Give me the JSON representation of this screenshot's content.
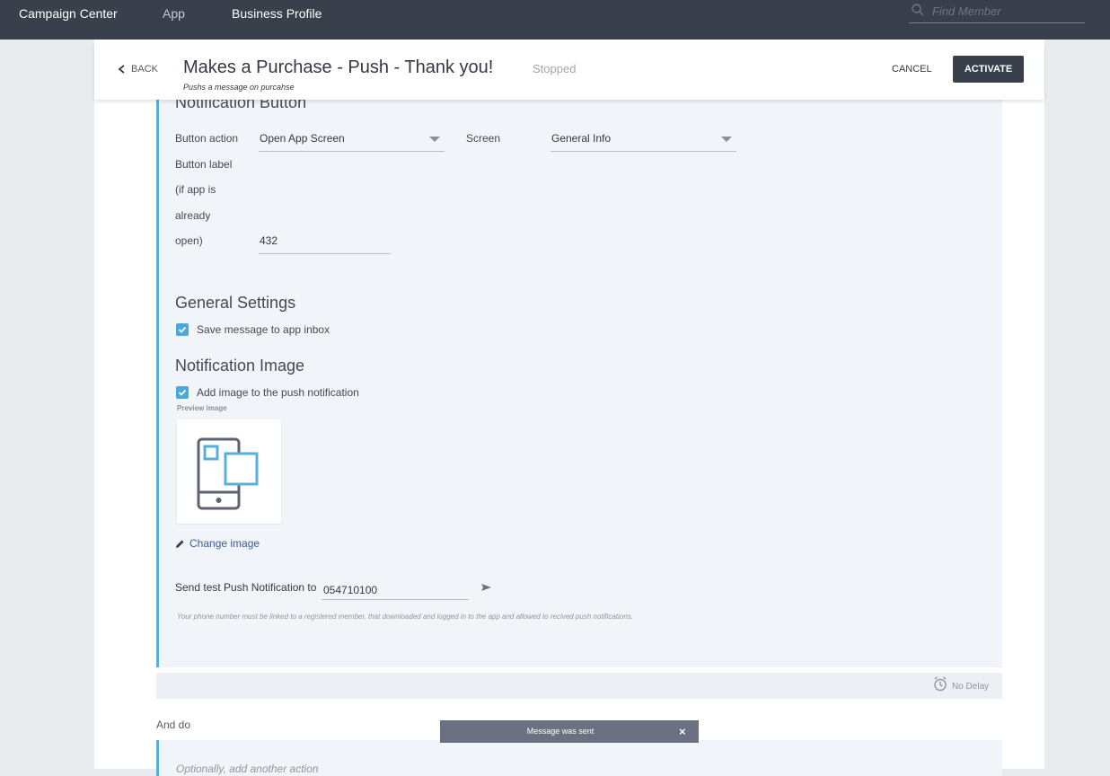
{
  "topnav": {
    "items": [
      {
        "label": "Campaign Center"
      },
      {
        "label": "App"
      },
      {
        "label": "Business Profile"
      }
    ],
    "search_placeholder": "Find Member"
  },
  "header": {
    "back_label": "BACK",
    "title": "Makes a Purchase - Push - Thank you!",
    "subtitle": "Pushs a message on purcahse",
    "status": "Stopped",
    "cancel_label": "CANCEL",
    "activate_label": "ACTIVATE"
  },
  "notification_button": {
    "heading": "Notification Button",
    "button_action_label": "Button action",
    "button_action_value": "Open App Screen",
    "screen_label": "Screen",
    "screen_value": "General Info",
    "button_label_lines": [
      "Button label",
      "(if app is",
      "already",
      "open)"
    ],
    "button_label_value": "432"
  },
  "general_settings": {
    "heading": "General Settings",
    "save_inbox_label": "Save message to app inbox",
    "save_inbox_checked": true
  },
  "notification_image": {
    "heading": "Notification Image",
    "add_image_label": "Add image to the push notification",
    "add_image_checked": true,
    "preview_label": "Preview image",
    "change_image_label": "Change image"
  },
  "test_push": {
    "label": "Send test Push Notification to",
    "value": "054710100",
    "note": "Your phone number must be linked to a registered member, that downloaded and logged in to the app and allowed to recived push notifications."
  },
  "delay": {
    "label": "No Delay"
  },
  "and_do": {
    "label": "And do",
    "optional_label": "Optionally, add another action"
  },
  "toast": {
    "message": "Message was sent",
    "close": "×"
  },
  "colors": {
    "nav_bg": "#3a3f4c",
    "accent_blue": "#5aafd9",
    "checkbox_blue": "#4da7db",
    "link_blue": "#3a5d9c"
  }
}
